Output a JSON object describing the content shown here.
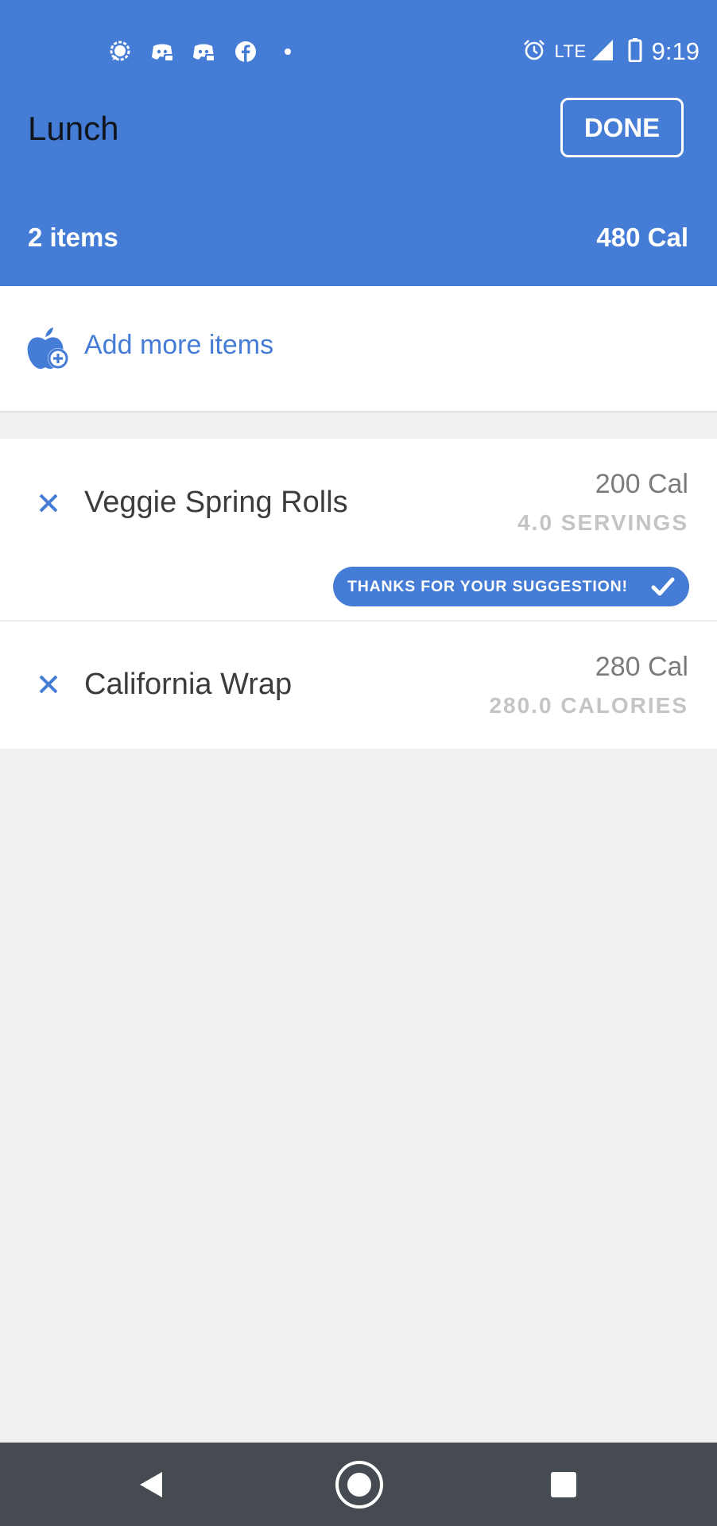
{
  "status_bar": {
    "notification_icons": [
      "signal-messenger-icon",
      "discord-icon",
      "discord-icon",
      "facebook-icon",
      "dot-icon"
    ],
    "alarm_icon": "alarm-clock-icon",
    "network": "LTE",
    "signal_icon": "cell-signal-icon",
    "battery_icon": "battery-icon",
    "time": "9:19"
  },
  "header": {
    "title": "Lunch",
    "done_label": "DONE",
    "item_count": "2 items",
    "total_calories": "480 Cal"
  },
  "add_items": {
    "icon": "apple-plus-icon",
    "label": "Add more items"
  },
  "items": [
    {
      "name": "Veggie Spring Rolls",
      "calories": "200 Cal",
      "amount": "4.0 SERVINGS",
      "feedback": "THANKS FOR YOUR SUGGESTION!"
    },
    {
      "name": "California Wrap",
      "calories": "280 Cal",
      "amount": "280.0 CALORIES"
    }
  ],
  "nav_bar": {
    "back_icon": "back-triangle-icon",
    "home_icon": "home-circle-icon",
    "recents_icon": "recents-square-icon"
  },
  "colors": {
    "primary": "#457cd6",
    "background": "#f0f0f0",
    "nav_bar": "#454b51"
  }
}
